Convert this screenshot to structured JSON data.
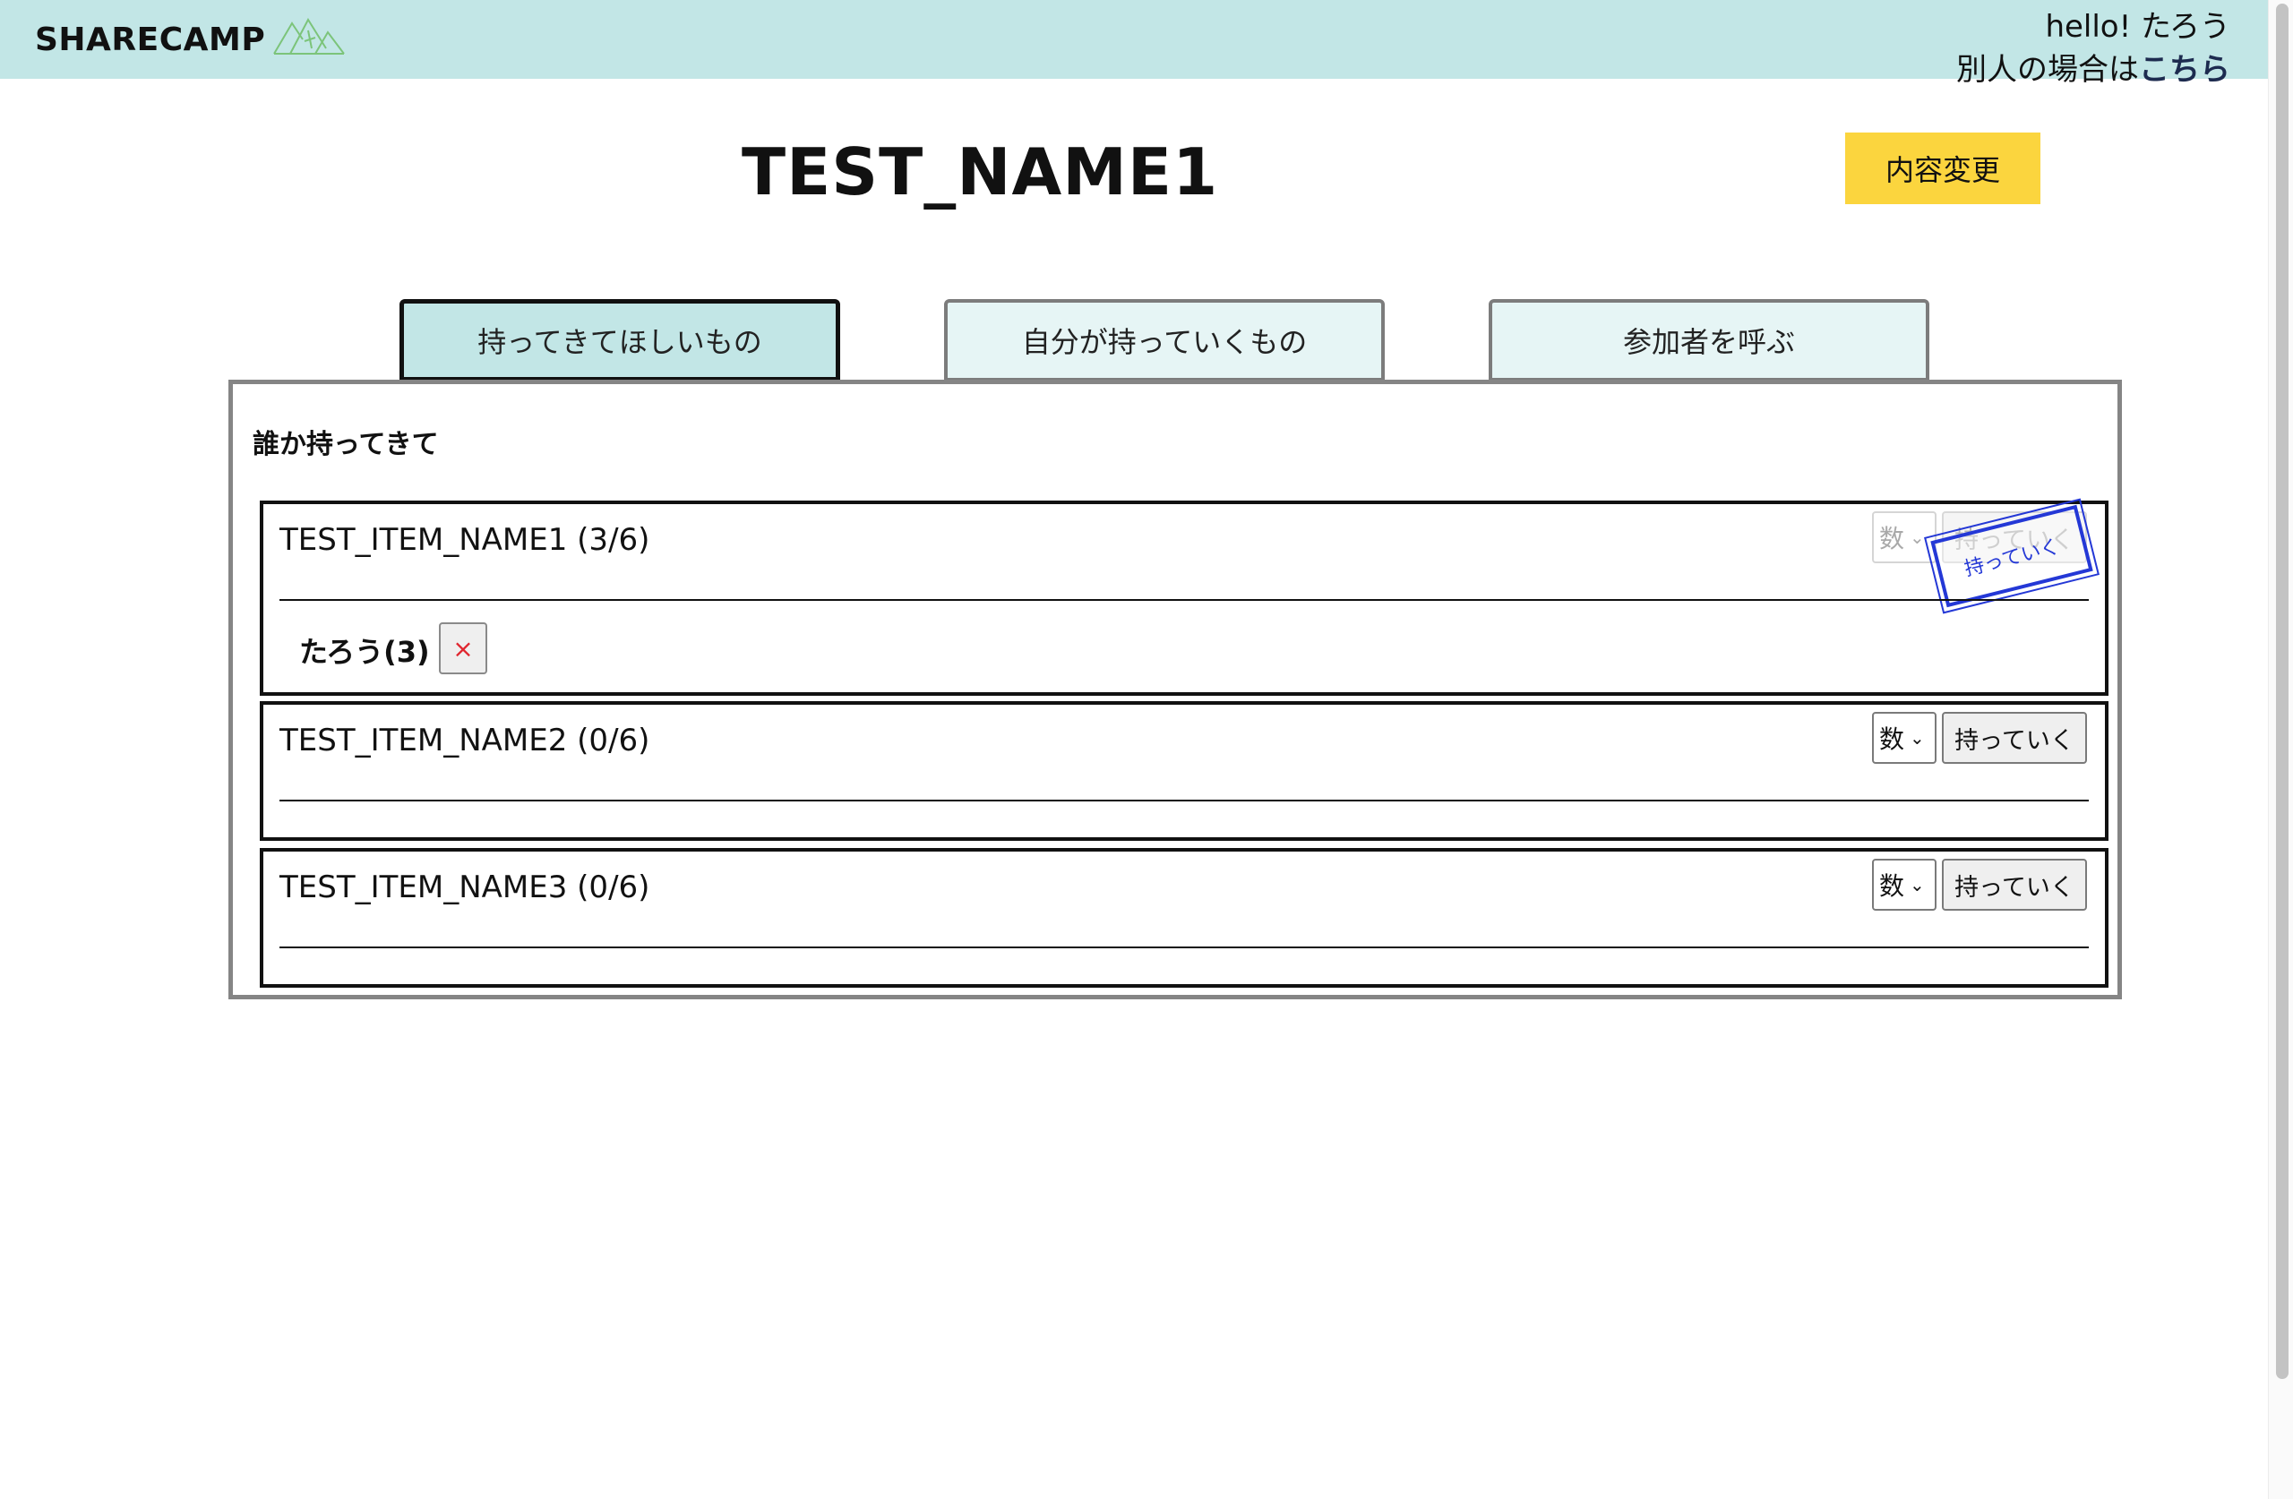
{
  "header": {
    "logo": "SHARECAMP",
    "logo_icon": "mountain-tent-icon",
    "greeting": "hello! たろう",
    "switch_prefix": "別人の場合は",
    "switch_link": "こちら"
  },
  "page": {
    "title": "TEST_NAME1",
    "edit_button": "内容変更"
  },
  "tabs": [
    {
      "label": "持ってきてほしいもの",
      "active": true
    },
    {
      "label": "自分が持っていくもの",
      "active": false
    },
    {
      "label": "参加者を呼ぶ",
      "active": false
    }
  ],
  "panel": {
    "heading": "誰か持ってきて",
    "items": [
      {
        "name": "TEST_ITEM_NAME1",
        "count": "(3/6)",
        "qty_placeholder": "数",
        "bring_label": "持っていく",
        "disabled": true,
        "stamp_text": "持っていく",
        "participants": [
          {
            "label": "たろう(3)",
            "remove_label": "×"
          }
        ]
      },
      {
        "name": "TEST_ITEM_NAME2",
        "count": "(0/6)",
        "qty_placeholder": "数",
        "bring_label": "持っていく",
        "disabled": false
      },
      {
        "name": "TEST_ITEM_NAME3",
        "count": "(0/6)",
        "qty_placeholder": "数",
        "bring_label": "持っていく",
        "disabled": false
      }
    ]
  },
  "colors": {
    "header_bg": "#c2e6e6",
    "edit_button_bg": "#fbd53e",
    "stamp": "#2438d6",
    "remove_x": "#e0262f"
  }
}
